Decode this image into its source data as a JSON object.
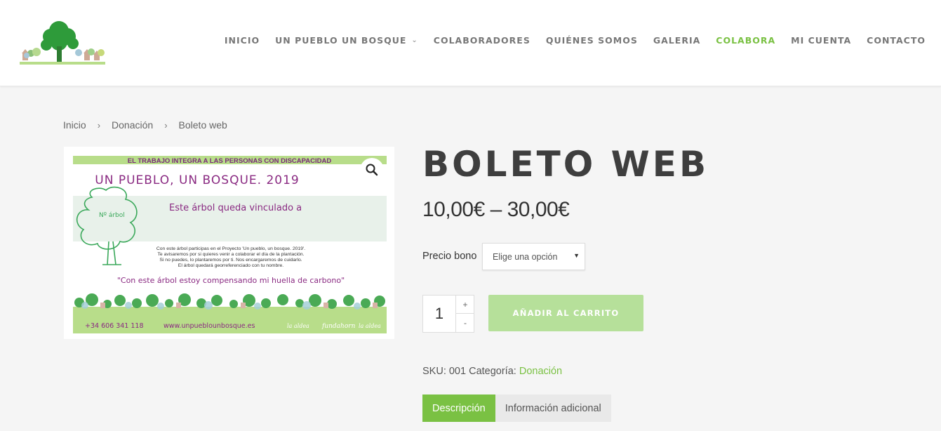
{
  "nav": {
    "items": [
      {
        "label": "INICIO",
        "name": "nav-inicio",
        "has_dropdown": false,
        "active": false
      },
      {
        "label": "UN PUEBLO UN BOSQUE",
        "name": "nav-un-pueblo-un-bosque",
        "has_dropdown": true,
        "active": false
      },
      {
        "label": "COLABORADORES",
        "name": "nav-colaboradores",
        "has_dropdown": false,
        "active": false
      },
      {
        "label": "QUIÉNES SOMOS",
        "name": "nav-quienes-somos",
        "has_dropdown": false,
        "active": false
      },
      {
        "label": "GALERIA",
        "name": "nav-galeria",
        "has_dropdown": false,
        "active": false
      },
      {
        "label": "COLABORA",
        "name": "nav-colabora",
        "has_dropdown": false,
        "active": true
      },
      {
        "label": "MI CUENTA",
        "name": "nav-mi-cuenta",
        "has_dropdown": false,
        "active": false
      },
      {
        "label": "CONTACTO",
        "name": "nav-contacto",
        "has_dropdown": false,
        "active": false
      }
    ]
  },
  "breadcrumb": {
    "home": "Inicio",
    "category": "Donación",
    "current": "Boleto web"
  },
  "ticket": {
    "banner": "EL TRABAJO INTEGRA A LAS PERSONAS CON DISCAPACIDAD",
    "heading": "UN PUEBLO, UN BOSQUE. 2019",
    "tree_label": "Nº árbol",
    "dedication": "Este árbol queda vinculado a",
    "line1": "Con este árbol participas en el Proyecto 'Un pueblo, un bosque. 2019'.",
    "line2": "Te avisaremos por si quieres venir a colaborar el día de la plantación.",
    "line3": "Si no puedes, lo plantaremos por ti. Nos encargaremos de cuidarlo.",
    "line4": "El árbol quedará georreferenciado con tu nombre.",
    "quote": "\"Con este árbol estoy compensando mi huella de carbono\"",
    "phone": "+34 606 341 118",
    "website": "www.unpueblounbosque.es",
    "logo1": "la aldea",
    "logo2": "fundahorn",
    "logo3": "la aldea"
  },
  "product": {
    "title": "BOLETO WEB",
    "price": "10,00€ – 30,00€",
    "variation_label": "Precio bono",
    "select_value": "Elige una opción",
    "quantity": "1",
    "plus": "+",
    "minus": "-",
    "add_to_cart": "AÑADIR AL CARRITO",
    "sku_text": "SKU: 001 Categoría:",
    "category_link": "Donación"
  },
  "tabs": [
    {
      "label": "Descripción",
      "active": true
    },
    {
      "label": "Información adicional",
      "active": false
    }
  ],
  "colors": {
    "accent": "#7ac143",
    "button_disabled": "#b6e09a",
    "title": "#3e3e3e",
    "ticket_green": "#b8dd8a",
    "ticket_purple": "#8a2a82"
  }
}
